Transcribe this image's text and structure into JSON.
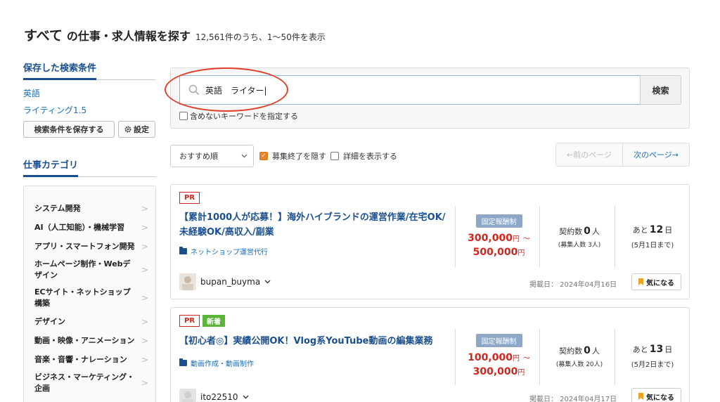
{
  "header": {
    "title_all": "すべて",
    "title_rest": "の仕事・求人情報を探す",
    "result_count": "12,561件のうち、1〜50件を表示"
  },
  "saved": {
    "title": "保存した検索条件",
    "items": [
      "英語",
      "ライティング1.5"
    ],
    "save_button": "検索条件を保存する",
    "settings_button": "設定"
  },
  "categories": {
    "title": "仕事カテゴリ",
    "items": [
      "システム開発",
      "AI（人工知能）・機械学習",
      "アプリ・スマートフォン開発",
      "ホームページ制作・Webデザイン",
      "ECサイト・ネットショップ構築",
      "デザイン",
      "動画・映像・アニメーション",
      "音楽・音響・ナレーション",
      "ビジネス・マーケティング・企画"
    ]
  },
  "search": {
    "value": "英語　ライター|",
    "button": "検索",
    "exclude_label": "含めないキーワードを指定する"
  },
  "sort": {
    "selected": "おすすめ順",
    "hide_closed": "募集終了を隠す",
    "show_details": "詳細を表示する",
    "prev_page": "←前のページ",
    "next_page": "次のページ→"
  },
  "jobs": [
    {
      "badge_pr": "PR",
      "title": "【累計1000人が応募！】海外ハイブランドの運営作業/在宅OK/未経験OK/高収入/副業",
      "category": "ネットショップ運営代行",
      "pay_type": "固定報酬制",
      "price_min": "300,000",
      "price_max": "500,000",
      "yen": "円",
      "tilde": "〜",
      "contracts_label": "契約数",
      "contracts": "0",
      "person_unit": "人",
      "recruit_note": "(募集人数 3人)",
      "remain_label": "あと",
      "remain_days": "12",
      "day_unit": "日",
      "deadline": "(5月1日まで)",
      "user": "bupan_buyma",
      "posted": "掲載日： 2024年04月16日",
      "fav": "気になる"
    },
    {
      "badge_pr": "PR",
      "badge_new": "新着",
      "title": "【初心者◎】実績公開OK！Vlog系YouTube動画の編集業務",
      "category": "動画作成・動画制作",
      "pay_type": "固定報酬制",
      "price_min": "100,000",
      "price_max": "300,000",
      "yen": "円",
      "tilde": "〜",
      "contracts_label": "契約数",
      "contracts": "0",
      "person_unit": "人",
      "recruit_note": "(募集人数 20人)",
      "remain_label": "あと",
      "remain_days": "13",
      "day_unit": "日",
      "deadline": "(5月2日まで)",
      "user": "ito22510",
      "posted": "掲載日： 2024年04月17日",
      "fav": "気になる"
    }
  ],
  "colors": {
    "link_blue": "#1a4f8f",
    "price_red": "#d0261d",
    "new_green": "#5bb53b",
    "annotation_red": "#e0402a"
  }
}
